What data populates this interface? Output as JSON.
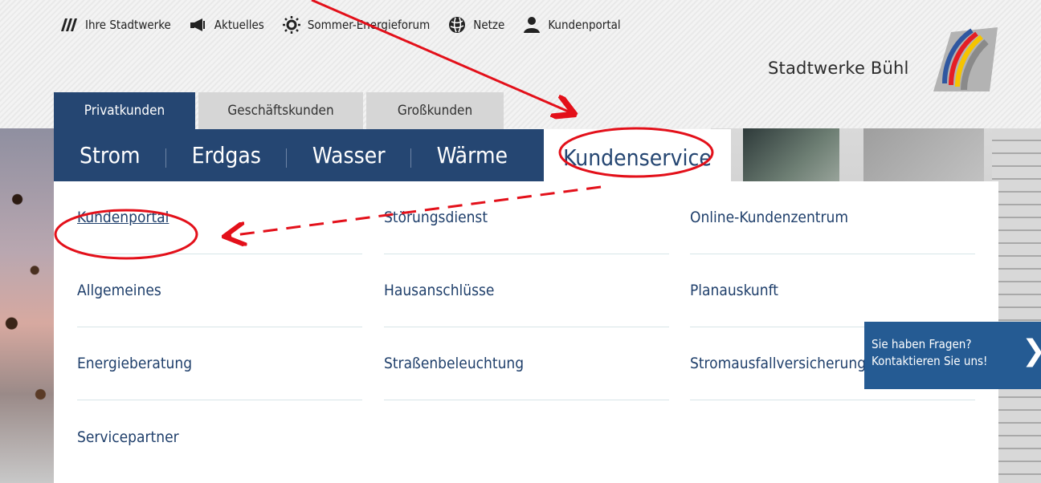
{
  "topnav": {
    "items": [
      {
        "label": "Ihre Stadtwerke",
        "icon": "stadtwerke-logo-icon"
      },
      {
        "label": "Aktuelles",
        "icon": "megaphone-icon"
      },
      {
        "label": "Sommer-Energieforum",
        "icon": "sun-icon"
      },
      {
        "label": "Netze",
        "icon": "globe-icon"
      },
      {
        "label": "Kundenportal",
        "icon": "user-icon"
      }
    ]
  },
  "logo": {
    "text": "Stadtwerke Bühl"
  },
  "tabs": [
    "Privatkunden",
    "Geschäftskunden",
    "Großkunden"
  ],
  "mainnav": {
    "items": [
      "Strom",
      "Erdgas",
      "Wasser",
      "Wärme"
    ],
    "active": "Kundenservice"
  },
  "menu": {
    "col1": [
      "Kundenportal",
      "Allgemeines",
      "Energieberatung",
      "Servicepartner"
    ],
    "col2": [
      "Störungsdienst",
      "Hausanschlüsse",
      "Straßenbeleuchtung"
    ],
    "col3": [
      "Online-Kundenzentrum",
      "Planauskunft",
      "Stromausfallversicherung"
    ]
  },
  "contact": {
    "line1": "Sie haben Fragen?",
    "line2": "Kontaktieren Sie uns!",
    "arrow": "❯"
  },
  "colors": {
    "nav_blue": "#254672",
    "link_blue": "#1f3f6b",
    "contact_blue": "#255b93",
    "annotation_red": "#e3101a"
  }
}
